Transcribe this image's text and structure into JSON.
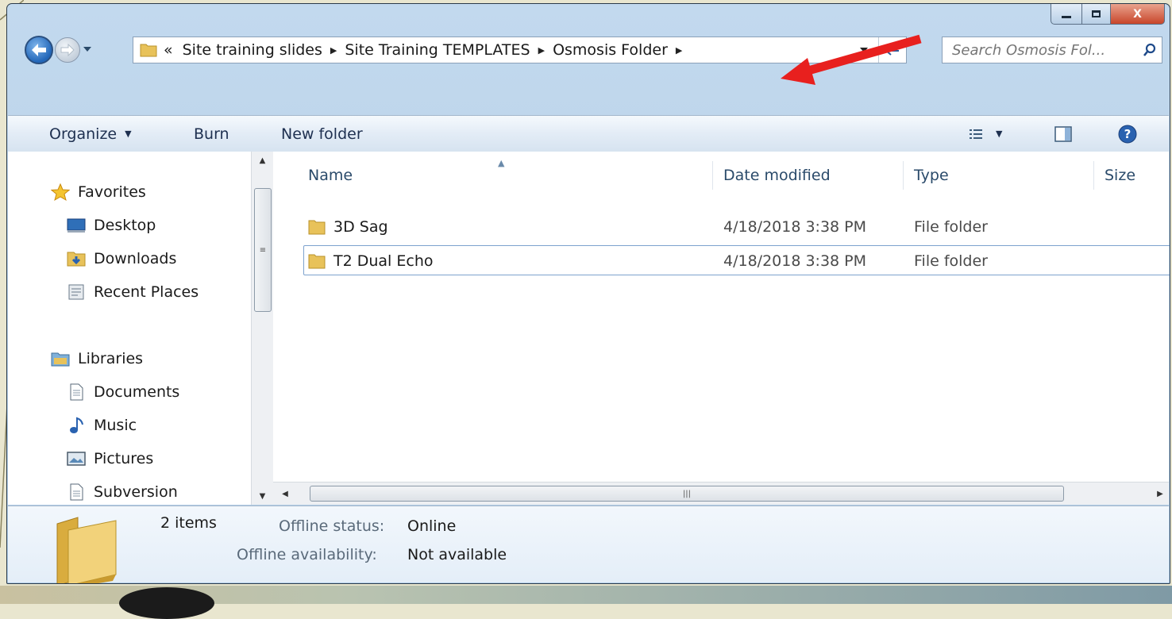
{
  "window": {
    "controls": {
      "minimize": "minimize",
      "maximize": "maximize",
      "close": "X"
    }
  },
  "address": {
    "overflow": "«",
    "crumbs": [
      "Site training slides",
      "Site Training TEMPLATES",
      "Osmosis Folder"
    ],
    "search_placeholder": "Search Osmosis Fol..."
  },
  "toolbar": {
    "organize": "Organize",
    "burn": "Burn",
    "new_folder": "New folder"
  },
  "nav": {
    "favorites": "Favorites",
    "desktop": "Desktop",
    "downloads": "Downloads",
    "recent_places": "Recent Places",
    "libraries": "Libraries",
    "documents": "Documents",
    "music": "Music",
    "pictures": "Pictures",
    "subversion": "Subversion"
  },
  "columns": {
    "name": "Name",
    "date": "Date modified",
    "type": "Type",
    "size": "Size"
  },
  "files": [
    {
      "name": "3D Sag",
      "date": "4/18/2018 3:38 PM",
      "type": "File folder"
    },
    {
      "name": "T2 Dual Echo",
      "date": "4/18/2018 3:38 PM",
      "type": "File folder"
    }
  ],
  "details": {
    "count": "2 items",
    "offline_status_label": "Offline status:",
    "offline_status_value": "Online",
    "offline_availability_label": "Offline availability:",
    "offline_availability_value": "Not available"
  },
  "colors": {
    "accent": "#2266b8",
    "annotation_arrow": "#e8201e",
    "folder": "#e8c25a"
  }
}
